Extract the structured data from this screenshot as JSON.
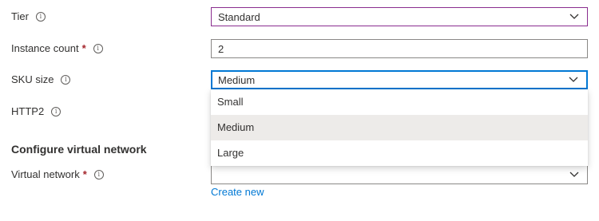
{
  "form": {
    "tier": {
      "label": "Tier",
      "value": "Standard"
    },
    "instance_count": {
      "label": "Instance count",
      "required_mark": "*",
      "value": "2"
    },
    "sku_size": {
      "label": "SKU size",
      "value": "Medium",
      "options": [
        "Small",
        "Medium",
        "Large"
      ],
      "selected_option": "Medium"
    },
    "http2": {
      "label": "HTTP2"
    },
    "section_title": "Configure virtual network",
    "virtual_network": {
      "label": "Virtual network",
      "required_mark": "*",
      "value": "",
      "create_new_link": "Create new"
    }
  },
  "icons": {
    "info": "info-icon",
    "chevron": "chevron-down-icon"
  },
  "colors": {
    "accent": "#0078d4",
    "required": "#a4262c",
    "tier_border": "#8a2d8f",
    "selected_bg": "#edebe9"
  }
}
